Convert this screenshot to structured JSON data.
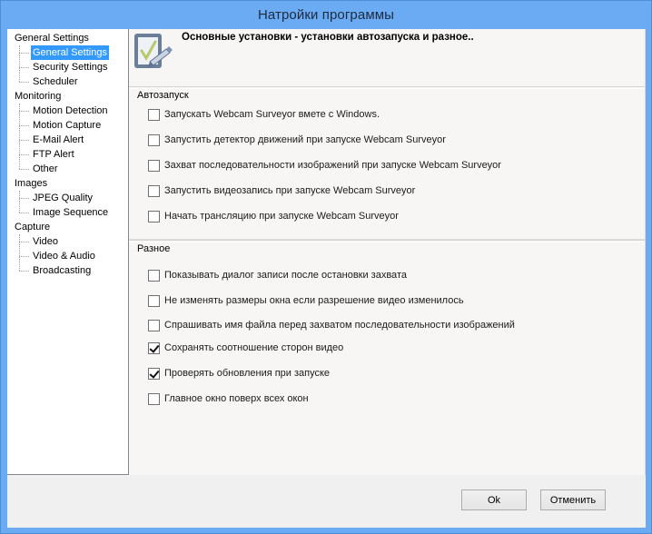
{
  "window": {
    "title": "Натройки программы"
  },
  "tree": {
    "groups": [
      {
        "label": "General Settings",
        "children": [
          {
            "label": "General Settings",
            "selected": true
          },
          {
            "label": "Security Settings",
            "selected": false
          },
          {
            "label": "Scheduler",
            "selected": false
          }
        ]
      },
      {
        "label": "Monitoring",
        "children": [
          {
            "label": "Motion Detection",
            "selected": false
          },
          {
            "label": "Motion Capture",
            "selected": false
          },
          {
            "label": "E-Mail Alert",
            "selected": false
          },
          {
            "label": "FTP Alert",
            "selected": false
          },
          {
            "label": "Other",
            "selected": false
          }
        ]
      },
      {
        "label": "Images",
        "children": [
          {
            "label": "JPEG Quality",
            "selected": false
          },
          {
            "label": "Image Sequence",
            "selected": false
          }
        ]
      },
      {
        "label": "Capture",
        "children": [
          {
            "label": "Video",
            "selected": false
          },
          {
            "label": "Video & Audio",
            "selected": false
          },
          {
            "label": "Broadcasting",
            "selected": false
          }
        ]
      }
    ]
  },
  "header": {
    "icon": "checklist-pen-icon",
    "title": "Основные установки - установки автозапуска и разное.."
  },
  "autostart": {
    "legend": "Автозапуск",
    "options": [
      {
        "label": "Запускать Webcam Surveyor вмете с Windows.",
        "checked": false
      },
      {
        "label": "Запустить детектор движений при запуске Webcam Surveyor",
        "checked": false
      },
      {
        "label": "Захват последовательности изображений при запуске Webcam Surveyor",
        "checked": false
      },
      {
        "label": "Запустить видеозапись при запуске Webcam Surveyor",
        "checked": false
      },
      {
        "label": "Начать трансляцию при запуске Webcam Surveyor",
        "checked": false
      }
    ]
  },
  "misc": {
    "legend": "Разное",
    "options": [
      {
        "label": "Показывать диалог записи после остановки захвата",
        "checked": false
      },
      {
        "label": "Не изменять размеры окна если разрешение видео изменилось",
        "checked": false
      },
      {
        "label": "Спрашивать имя файла перед захватом последовательности изображений",
        "checked": false
      },
      {
        "label": "Сохранять соотношение сторон видео",
        "checked": true
      },
      {
        "label": "Проверять обновления при запуске",
        "checked": true
      },
      {
        "label": "Главное окно поверх всех окон",
        "checked": false
      }
    ]
  },
  "footer": {
    "ok_label": "Ok",
    "cancel_label": "Отменить"
  },
  "colors": {
    "frame": "#6aabf3",
    "selection": "#3399ff"
  }
}
